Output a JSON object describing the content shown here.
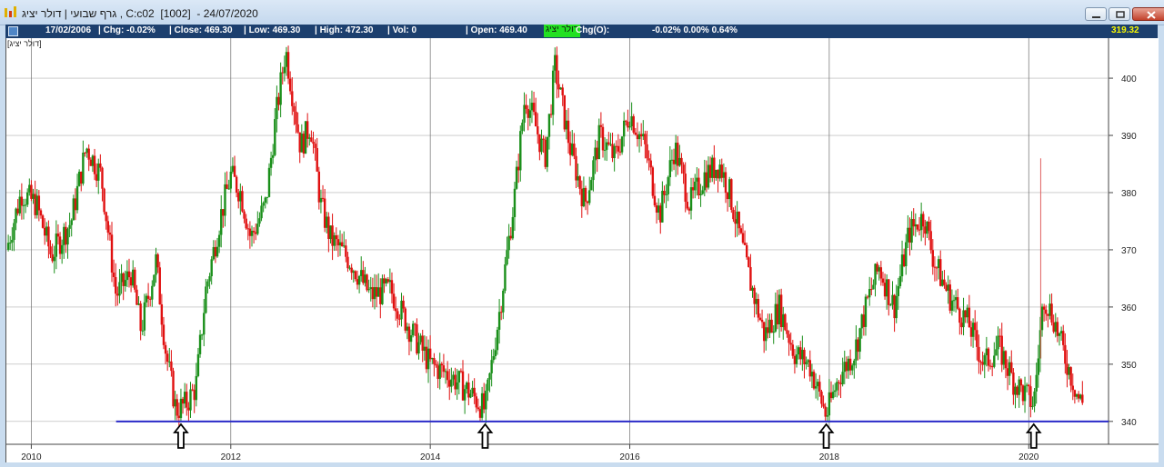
{
  "window": {
    "title": "גרף שבועי | דולר יציג , C:c02  [1002]  - 24/07/2020"
  },
  "infobar": {
    "date": "17/02/2006",
    "chg": "| Chg: -0.02%",
    "close": "| Close: 469.30",
    "low": "| Low: 469.30",
    "high": "| High: 472.30",
    "vol": "| Vol: 0",
    "open": "| Open: 469.40",
    "badge": "דולר יציג",
    "chg_open": "Chg(O):",
    "chg_values": "-0.02% 0.00% 0.64%",
    "last_price": "319.32"
  },
  "chart_label": "[דולר יציג]",
  "colors": {
    "up": "#1a8f1a",
    "down": "#e01010",
    "support": "#2b2bc8",
    "grid": "#b0b0b0"
  },
  "chart_data": {
    "type": "candlestick",
    "x_ticks": [
      "2010",
      "2012",
      "2014",
      "2016",
      "2018",
      "2020"
    ],
    "y_ticks": [
      340,
      350,
      360,
      370,
      380,
      390,
      400
    ],
    "xlim": [
      2009.75,
      2020.8
    ],
    "ylim": [
      336,
      407
    ],
    "support_level": 340,
    "marked_lows": [
      2011.5,
      2014.55,
      2017.97,
      2020.05
    ],
    "anchors": [
      [
        2009.75,
        370
      ],
      [
        2009.9,
        380
      ],
      [
        2010.05,
        378
      ],
      [
        2010.2,
        369
      ],
      [
        2010.4,
        375
      ],
      [
        2010.55,
        388
      ],
      [
        2010.7,
        383
      ],
      [
        2010.85,
        362
      ],
      [
        2011.0,
        366
      ],
      [
        2011.1,
        356
      ],
      [
        2011.25,
        368
      ],
      [
        2011.35,
        352
      ],
      [
        2011.45,
        342
      ],
      [
        2011.55,
        343
      ],
      [
        2011.65,
        346
      ],
      [
        2011.75,
        363
      ],
      [
        2011.9,
        376
      ],
      [
        2012.0,
        383
      ],
      [
        2012.1,
        380
      ],
      [
        2012.2,
        372
      ],
      [
        2012.35,
        378
      ],
      [
        2012.45,
        393
      ],
      [
        2012.55,
        405
      ],
      [
        2012.7,
        388
      ],
      [
        2012.8,
        392
      ],
      [
        2012.9,
        378
      ],
      [
        2013.0,
        372
      ],
      [
        2013.2,
        368
      ],
      [
        2013.4,
        362
      ],
      [
        2013.6,
        363
      ],
      [
        2013.8,
        356
      ],
      [
        2014.0,
        350
      ],
      [
        2014.2,
        348
      ],
      [
        2014.4,
        345
      ],
      [
        2014.55,
        342
      ],
      [
        2014.7,
        360
      ],
      [
        2014.85,
        380
      ],
      [
        2014.95,
        397
      ],
      [
        2015.05,
        392
      ],
      [
        2015.15,
        386
      ],
      [
        2015.25,
        402
      ],
      [
        2015.4,
        388
      ],
      [
        2015.55,
        378
      ],
      [
        2015.7,
        390
      ],
      [
        2015.85,
        386
      ],
      [
        2016.0,
        394
      ],
      [
        2016.15,
        388
      ],
      [
        2016.3,
        376
      ],
      [
        2016.45,
        388
      ],
      [
        2016.6,
        378
      ],
      [
        2016.75,
        383
      ],
      [
        2016.9,
        385
      ],
      [
        2017.0,
        380
      ],
      [
        2017.2,
        365
      ],
      [
        2017.35,
        355
      ],
      [
        2017.5,
        360
      ],
      [
        2017.65,
        352
      ],
      [
        2017.8,
        350
      ],
      [
        2017.97,
        341
      ],
      [
        2018.1,
        348
      ],
      [
        2018.25,
        352
      ],
      [
        2018.4,
        362
      ],
      [
        2018.5,
        367
      ],
      [
        2018.65,
        360
      ],
      [
        2018.8,
        373
      ],
      [
        2018.95,
        376
      ],
      [
        2019.05,
        368
      ],
      [
        2019.2,
        362
      ],
      [
        2019.4,
        357
      ],
      [
        2019.55,
        350
      ],
      [
        2019.7,
        353
      ],
      [
        2019.85,
        347
      ],
      [
        2020.0,
        344
      ],
      [
        2020.05,
        343
      ],
      [
        2020.15,
        362
      ],
      [
        2020.25,
        358
      ],
      [
        2020.35,
        352
      ],
      [
        2020.5,
        344
      ],
      [
        2020.55,
        343
      ]
    ],
    "spike": {
      "x": 2020.12,
      "high": 386,
      "low": 351
    }
  }
}
